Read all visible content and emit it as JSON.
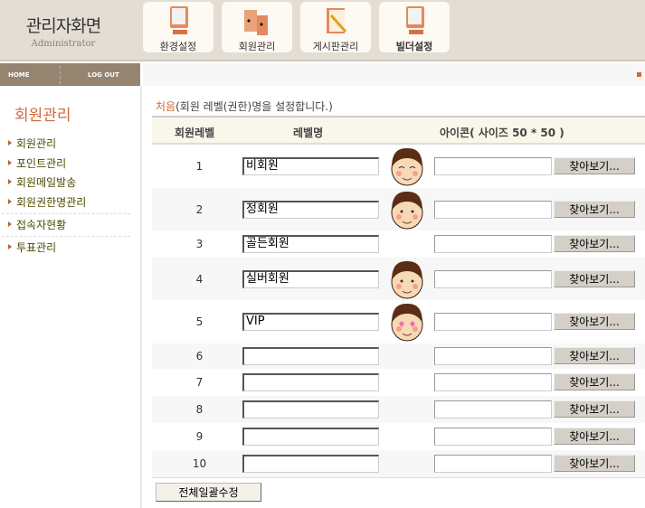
{
  "header": {
    "title": "관리자화면",
    "subtitle": "Administrator",
    "menus": [
      {
        "label": "환경설정",
        "icon": "monitor-icon"
      },
      {
        "label": "회원관리",
        "icon": "members-icon"
      },
      {
        "label": "게시판관리",
        "icon": "board-icon"
      },
      {
        "label": "빌더설정",
        "icon": "monitor-icon"
      }
    ]
  },
  "nav": {
    "home": "HOME",
    "logout": "LOG OUT"
  },
  "sidebar": {
    "title": "회원관리",
    "items": [
      "회원관리",
      "포인트관리",
      "회원메일발송",
      "회원권한명관리",
      "접속자현황",
      "투표관리"
    ]
  },
  "intro": {
    "accent": "처음",
    "text": "(회원 레벨(권한)명을 설정합니다.)"
  },
  "table": {
    "headers": [
      "회원레벨",
      "레벨명",
      "아이콘( 사이즈 50 * 50 )"
    ],
    "browse_label": "찾아보기...",
    "rows": [
      {
        "level": "1",
        "name": "비회원",
        "icon": "smiling-face"
      },
      {
        "level": "2",
        "name": "정회원",
        "icon": "face"
      },
      {
        "level": "3",
        "name": "골든회원",
        "icon": ""
      },
      {
        "level": "4",
        "name": "실버회원",
        "icon": "face"
      },
      {
        "level": "5",
        "name": "VIP",
        "icon": "heart-eyes-face"
      },
      {
        "level": "6",
        "name": "",
        "icon": ""
      },
      {
        "level": "7",
        "name": "",
        "icon": ""
      },
      {
        "level": "8",
        "name": "",
        "icon": ""
      },
      {
        "level": "9",
        "name": "",
        "icon": ""
      },
      {
        "level": "10",
        "name": "",
        "icon": ""
      }
    ]
  },
  "save_all": "전체일괄수정"
}
